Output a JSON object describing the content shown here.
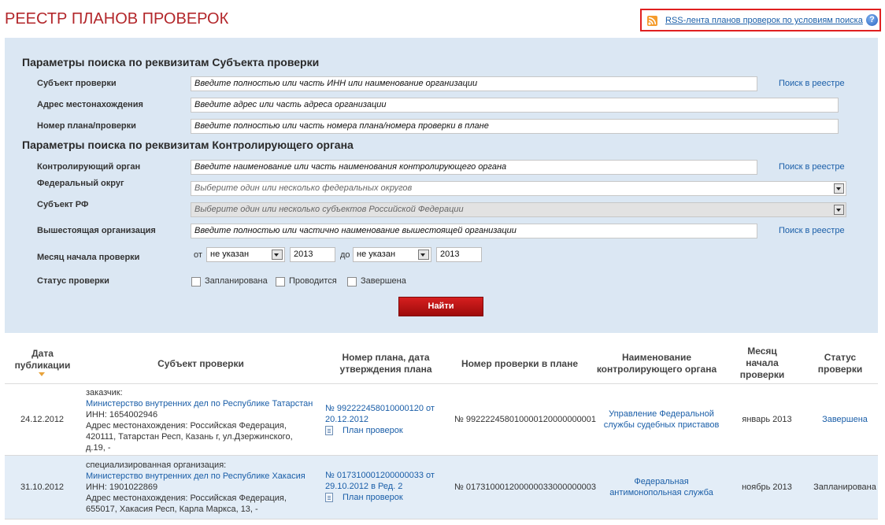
{
  "page": {
    "title": "РЕЕСТР ПЛАНОВ ПРОВЕРОК"
  },
  "rss": {
    "link": "RSS-лента планов проверок по условиям поиска",
    "help": "?"
  },
  "search": {
    "subject_section": "Параметры поиска по реквизитам Субъекта проверки",
    "authority_section": "Параметры поиска по реквизитам Контролирующего органа",
    "registry_link": "Поиск в реестре",
    "fields": {
      "subject": {
        "label": "Субъект проверки",
        "placeholder": "Введите полностью или часть ИНН или наименование организации"
      },
      "address": {
        "label": "Адрес местонахождения",
        "placeholder": "Введите адрес или часть адреса организации"
      },
      "plan_number": {
        "label": "Номер плана/проверки",
        "placeholder": "Введите полностью или часть номера плана/номера проверки в плане"
      },
      "authority": {
        "label": "Контролирующий орган",
        "placeholder": "Введите наименование или часть наименования контролирующего органа"
      },
      "district": {
        "label": "Федеральный округ",
        "placeholder": "Выберите один или несколько федеральных округов"
      },
      "region": {
        "label": "Субъект РФ",
        "placeholder": "Выберите один или несколько субъектов Российской Федерации"
      },
      "parent_org": {
        "label": "Вышестоящая организация",
        "placeholder": "Введите полностью или частично наименование вышестоящей организации"
      }
    },
    "month": {
      "label": "Месяц начала проверки",
      "from_label": "от",
      "from_month": "не указан",
      "from_year": "2013",
      "to_label": "до",
      "to_month": "не указан",
      "to_year": "2013"
    },
    "status": {
      "label": "Статус проверки",
      "options": [
        "Запланирована",
        "Проводится",
        "Завершена"
      ]
    },
    "find_button": "Найти"
  },
  "table": {
    "headers": {
      "date": [
        "Дата",
        "публикации"
      ],
      "subject": "Субъект проверки",
      "plan": [
        "Номер плана, дата",
        "утверждения плана"
      ],
      "check_number": "Номер проверки в плане",
      "authority": [
        "Наименование",
        "контролирующего органа"
      ],
      "month": [
        "Месяц",
        "начала",
        "проверки"
      ],
      "status": [
        "Статус",
        "проверки"
      ]
    },
    "rows": [
      {
        "date": "24.12.2012",
        "role": "заказчик:",
        "org": "Министерство внутренних дел по Республике Татарстан",
        "inn": "ИНН: 1654002946",
        "address": [
          "Адрес местонахождения: Российская Федерация,",
          "420111, Татарстан Респ, Казань г, ул.Дзержинского,",
          "д.19, -"
        ],
        "plan": [
          "№ 992222458010000120 от",
          "20.12.2012"
        ],
        "plan_doc": "План проверок",
        "check_number": "№ 992222458010000120000000001",
        "authority": [
          "Управление Федеральной",
          "службы судебных приставов"
        ],
        "month": "январь 2013",
        "status": "Завершена"
      },
      {
        "date": "31.10.2012",
        "role": "специализированная организация:",
        "org": "Министерство внутренних дел по Республике Хакасия",
        "inn": "ИНН: 1901022869",
        "address": [
          "Адрес местонахождения: Российская Федерация,",
          "655017, Хакасия Респ, Карла Маркса, 13, -"
        ],
        "plan": [
          "№ 017310001200000033 от",
          "29.10.2012 в Ред. 2"
        ],
        "plan_doc": "План проверок",
        "check_number": "№ 017310001200000033000000003",
        "authority": [
          "Федеральная",
          "антимонопольная служба"
        ],
        "month": "ноябрь 2013",
        "status": "Запланирована"
      }
    ]
  }
}
